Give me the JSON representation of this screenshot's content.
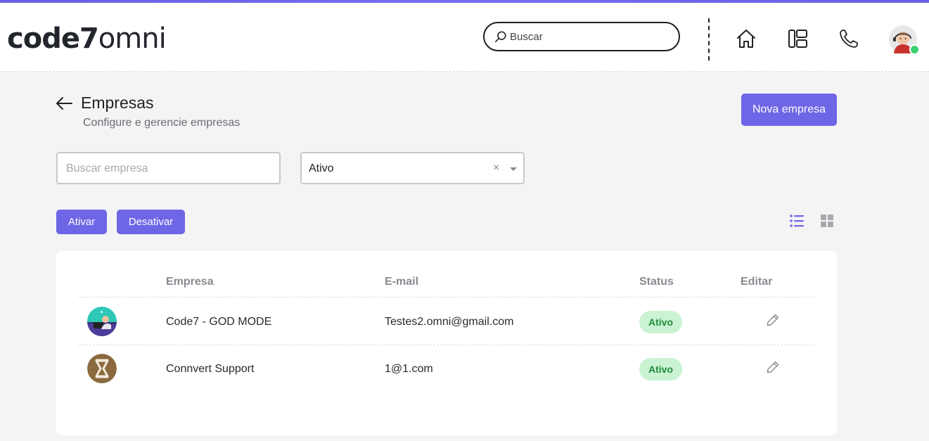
{
  "app": {
    "logo_bold": "code7",
    "logo_light": "omni"
  },
  "header": {
    "search_placeholder": "Buscar",
    "icons": [
      "search-icon",
      "home-icon",
      "layout-icon",
      "phone-icon",
      "avatar"
    ]
  },
  "page": {
    "title": "Empresas",
    "subtitle": "Configure e gerencie empresas",
    "new_button": "Nova empresa"
  },
  "filters": {
    "search_placeholder": "Buscar empresa",
    "status_value": "Ativo",
    "clear_symbol": "×"
  },
  "actions": {
    "activate": "Ativar",
    "deactivate": "Desativar"
  },
  "table": {
    "columns": [
      "Empresa",
      "E-mail",
      "Status",
      "Editar"
    ],
    "rows": [
      {
        "company": "Code7 - GOD MODE",
        "email": "Testes2.omni@gmail.com",
        "status": "Ativo"
      },
      {
        "company": "Connvert Support",
        "email": "1@1.com",
        "status": "Ativo"
      }
    ]
  },
  "colors": {
    "accent": "#6e66e6",
    "status_bg": "#c9f3d2",
    "status_text": "#1f8a3a",
    "online": "#3bd16f"
  }
}
